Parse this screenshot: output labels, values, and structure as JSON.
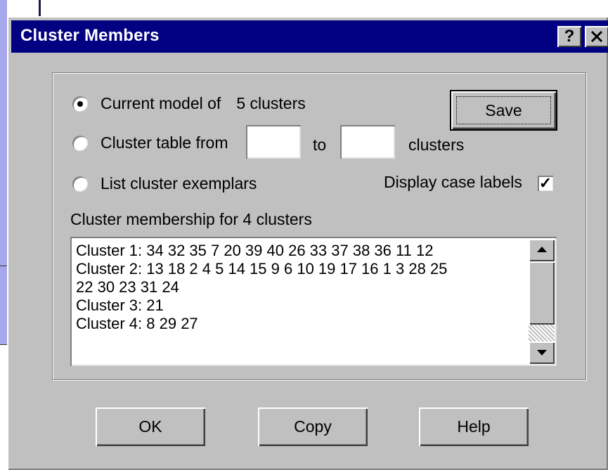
{
  "window": {
    "title": "Cluster Members",
    "help_label": "?",
    "close_label": "✕"
  },
  "options": {
    "current_model_label": "Current model of",
    "current_model_value": "5 clusters",
    "cluster_table_label": "Cluster table from",
    "cluster_table_to": "to",
    "cluster_table_suffix": "clusters",
    "cluster_table_from_value": "",
    "cluster_table_to_value": "",
    "list_exemplars_label": "List cluster exemplars",
    "selected_option": "current_model"
  },
  "save_label": "Save",
  "display_case_labels": {
    "label": "Display case labels",
    "checked": true,
    "check_mark": "✓"
  },
  "membership": {
    "heading": "Cluster membership for 4 clusters",
    "lines": [
      "Cluster 1: 34 32 35 7 20 39 40 26 33 37 38 36 11 12",
      "Cluster 2: 13 18 2 4 5 14 15 9 6 10 19 17 16 1 3 28 25",
      "22 30 23 31 24",
      "Cluster 3: 21",
      "Cluster 4: 8 29 27"
    ]
  },
  "buttons": {
    "ok": "OK",
    "copy": "Copy",
    "help": "Help"
  },
  "colors": {
    "titlebar": "#020182",
    "dialog_face": "#c0c0c0",
    "background_window": "#a7a7ee"
  }
}
